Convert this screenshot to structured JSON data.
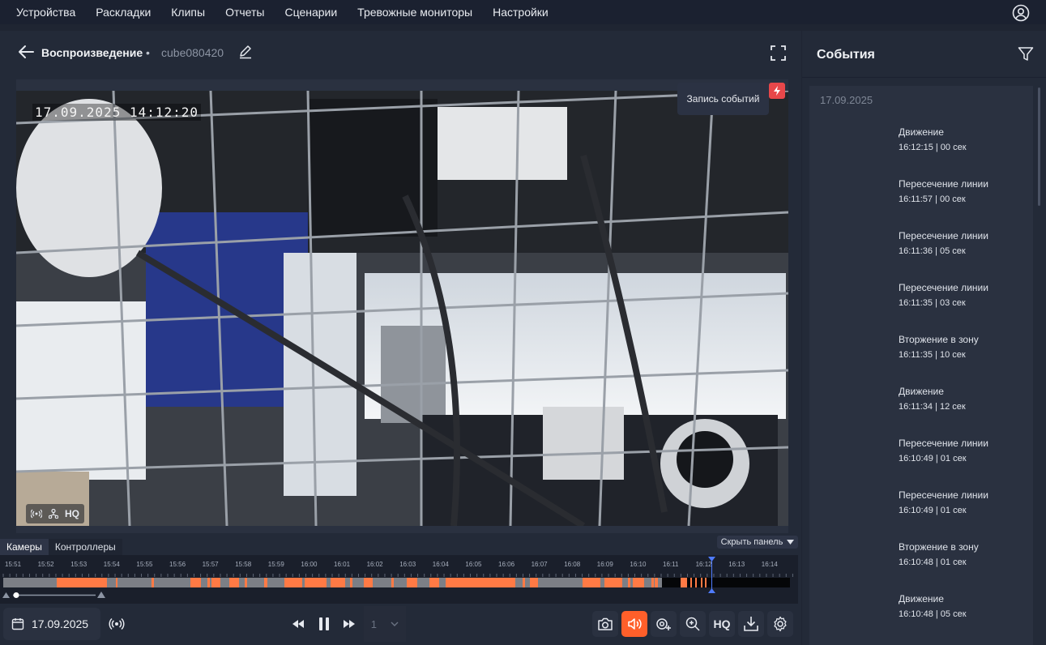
{
  "nav": {
    "items": [
      "Устройства",
      "Раскладки",
      "Клипы",
      "Отчеты",
      "Сценарии",
      "Тревожные мониторы",
      "Настройки"
    ]
  },
  "player": {
    "title": "Воспроизведение",
    "separator": "•",
    "camera_name": "cube080420",
    "osd_timestamp": "17.09.2025 14:12:20",
    "tooltip": "Запись событий",
    "quality_badge": "HQ",
    "tabs": [
      "Камеры",
      "Контроллеры"
    ],
    "hide_panel": "Скрыть панель",
    "timeline_ticks": [
      "15:51",
      "15:52",
      "15:53",
      "15:54",
      "15:55",
      "15:56",
      "15:57",
      "15:58",
      "15:59",
      "16:00",
      "16:01",
      "16:02",
      "16:03",
      "16:04",
      "16:05",
      "16:06",
      "16:07",
      "16:08",
      "16:09",
      "16:10",
      "16:11",
      "16:12",
      "16:13",
      "16:14"
    ],
    "date": "17.09.2025",
    "speed_value": "1",
    "hq_button": "HQ",
    "colors": {
      "accent": "#ff5f2a",
      "event_segment": "#ff7a45",
      "recording": "#7c7f86"
    }
  },
  "events": {
    "title": "События",
    "date": "17.09.2025",
    "items": [
      {
        "name": "Движение",
        "time": "16:12:15 | 00 сек"
      },
      {
        "name": "Пересечение линии",
        "time": "16:11:57 | 00 сек"
      },
      {
        "name": "Пересечение линии",
        "time": "16:11:36 | 05 сек"
      },
      {
        "name": "Пересечение линии",
        "time": "16:11:35 | 03 сек"
      },
      {
        "name": "Вторжение в зону",
        "time": "16:11:35 | 10 сек"
      },
      {
        "name": "Движение",
        "time": "16:11:34 | 12 сек"
      },
      {
        "name": "Пересечение линии",
        "time": "16:10:49 | 01 сек"
      },
      {
        "name": "Пересечение линии",
        "time": "16:10:49 | 01 сек"
      },
      {
        "name": "Вторжение в зону",
        "time": "16:10:48 | 01 сек"
      },
      {
        "name": "Движение",
        "time": "16:10:48 | 05 сек"
      }
    ]
  }
}
